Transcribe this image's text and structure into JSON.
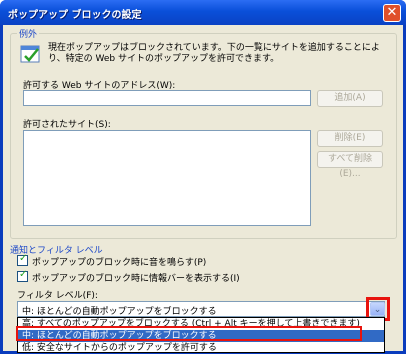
{
  "window": {
    "title": "ポップアップ ブロックの設定",
    "close_glyph": "✕"
  },
  "exceptions": {
    "legend": "例外",
    "description": "現在ポップアップはブロックされています。下の一覧にサイトを追加することにより、特定の Web サイトのポップアップを許可できます。",
    "address_label": "許可する Web サイトのアドレス(W):",
    "address_value": "",
    "add_button": "追加(A)",
    "allowed_label": "許可されたサイト(S):",
    "remove_button": "削除(E)",
    "remove_all_button": "すべて削除(E)..."
  },
  "notifications": {
    "legend": "通知とフィルタ レベル",
    "sound_label": "ポップアップのブロック時に音を鳴らす(P)",
    "sound_checked": true,
    "infobar_label": "ポップアップのブロック時に情報バーを表示する(I)",
    "infobar_checked": true,
    "filter_label": "フィルタ レベル(F):",
    "filter_selected": "中: ほとんどの自動ポップアップをブロックする",
    "dropdown_arrow": "⌄",
    "filter_options": [
      "高: すべてのポップアップをブロックする (Ctrl + Alt キーを押して上書きできます)",
      "中: ほとんどの自動ポップアップをブロックする",
      "低: 安全なサイトからのポップアップを許可する"
    ],
    "highlighted_option_index": 1
  },
  "colors": {
    "accent_blue": "#0a3cbd",
    "highlight": "#316ac5",
    "red_outline": "#e8140e"
  }
}
